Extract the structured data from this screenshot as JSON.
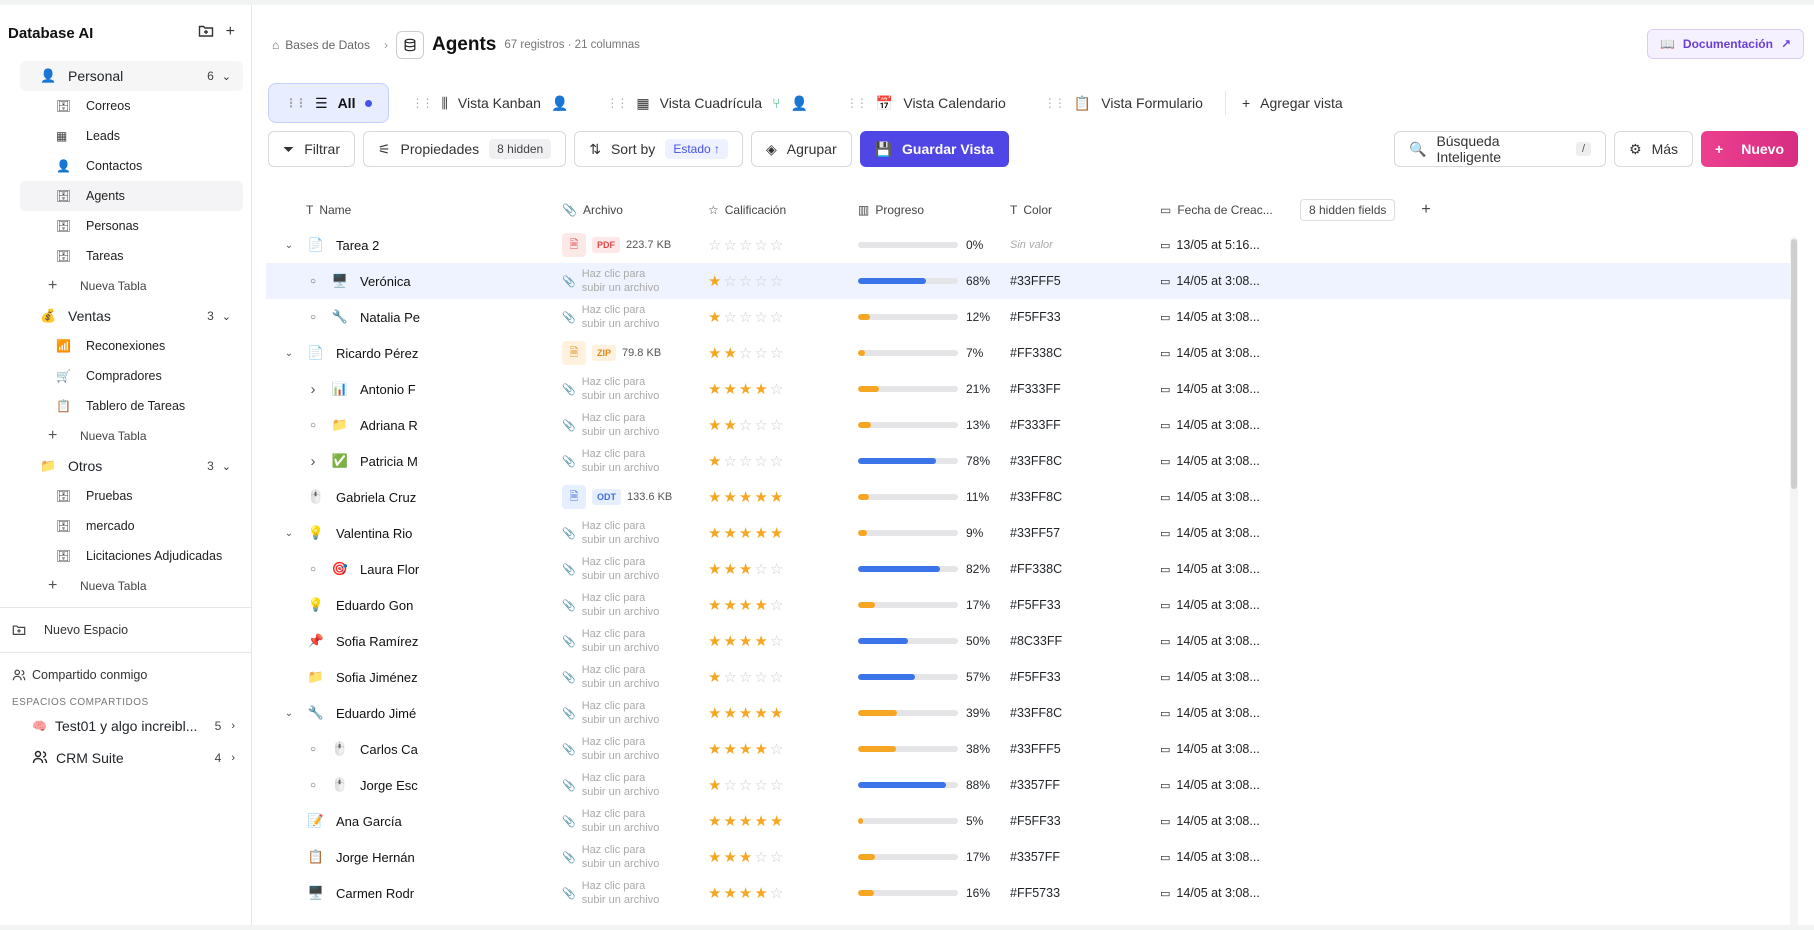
{
  "sidebar": {
    "title": "Database AI",
    "spaces": [
      {
        "name": "Personal",
        "count": "6",
        "icon": "person-icon",
        "tables": [
          "Correos",
          "Leads",
          "Contactos",
          "Agents",
          "Personas",
          "Tareas"
        ],
        "new_label": "Nueva Tabla"
      },
      {
        "name": "Ventas",
        "count": "3",
        "icon": "money-bag-icon",
        "tables": [
          "Reconexiones",
          "Compradores",
          "Tablero de Tareas"
        ],
        "new_label": "Nueva Tabla"
      },
      {
        "name": "Otros",
        "count": "3",
        "icon": "folder-icon",
        "tables": [
          "Pruebas",
          "mercado",
          "Licitaciones Adjudicadas"
        ],
        "new_label": "Nueva Tabla"
      }
    ],
    "new_space": "Nuevo Espacio",
    "shared_with_me": "Compartido conmigo",
    "shared_label": "ESPACIOS COMPARTIDOS",
    "shared": [
      {
        "name": "Test01 y algo increibl...",
        "count": "5"
      },
      {
        "name": "CRM Suite",
        "count": "4"
      }
    ]
  },
  "header": {
    "breadcrumb": "Bases de Datos",
    "title": "Agents",
    "meta": "67 registros · 21 columnas",
    "doc_button": "Documentación"
  },
  "views": {
    "all": "All",
    "kanban": "Vista Kanban",
    "grid": "Vista Cuadrícula",
    "calendar": "Vista Calendario",
    "form": "Vista Formulario",
    "add": "Agregar vista"
  },
  "toolbar": {
    "filter": "Filtrar",
    "props": "Propiedades",
    "props_badge": "8 hidden",
    "sort": "Sort by",
    "sort_badge": "Estado ↑",
    "group": "Agrupar",
    "save": "Guardar Vista",
    "search": "Búsqueda Inteligente",
    "search_key": "/",
    "more": "Más",
    "new": "Nuevo"
  },
  "columns": {
    "name": "Name",
    "file": "Archivo",
    "rating": "Calificación",
    "progress": "Progreso",
    "color": "Color",
    "date": "Fecha de Creac...",
    "hidden": "8 hidden fields"
  },
  "upload_text": [
    "Haz clic para",
    "subir un archivo"
  ],
  "no_value": "Sin valor",
  "rows": [
    {
      "name": "Tarea 2",
      "level": 0,
      "exp": "v",
      "icon": "doc-icon",
      "file": {
        "tag": "PDF",
        "size": "223.7 KB",
        "bg": "#fde8e8",
        "fg": "#e04a4a"
      },
      "rating": 0,
      "progress": 0,
      "color": "Sin valor",
      "date": "13/05 at 5:16..."
    },
    {
      "name": "Verónica",
      "level": 1,
      "exp": "○",
      "icon": "🖥️",
      "rating": 1,
      "progress": 68,
      "color": "#33FFF5",
      "date": "14/05 at 3:08...",
      "hl": true
    },
    {
      "name": "Natalia Pe",
      "level": 1,
      "exp": "○",
      "icon": "🔧",
      "rating": 1,
      "progress": 12,
      "color": "#F5FF33",
      "date": "14/05 at 3:08..."
    },
    {
      "name": "Ricardo Pérez",
      "level": 0,
      "exp": "v",
      "icon": "doc-icon",
      "file": {
        "tag": "ZIP",
        "size": "79.8 KB",
        "bg": "#fff1dd",
        "fg": "#e08a1a"
      },
      "rating": 2,
      "progress": 7,
      "color": "#FF338C",
      "date": "14/05 at 3:08..."
    },
    {
      "name": "Antonio F",
      "level": 1,
      "exp": ">",
      "icon": "📊",
      "rating": 4,
      "progress": 21,
      "color": "#F333FF",
      "date": "14/05 at 3:08..."
    },
    {
      "name": "Adriana R",
      "level": 1,
      "exp": "○",
      "icon": "📁",
      "rating": 2,
      "progress": 13,
      "color": "#F333FF",
      "date": "14/05 at 3:08..."
    },
    {
      "name": "Patricia M",
      "level": 1,
      "exp": ">",
      "icon": "✅",
      "rating": 1,
      "progress": 78,
      "color": "#33FF8C",
      "date": "14/05 at 3:08..."
    },
    {
      "name": "Gabriela Cruz",
      "level": 0,
      "exp": "",
      "icon": "🖱️",
      "file": {
        "tag": "ODT",
        "size": "133.6 KB",
        "bg": "#e6efff",
        "fg": "#3d6fe0"
      },
      "rating": 5,
      "progress": 11,
      "color": "#33FF8C",
      "date": "14/05 at 3:08..."
    },
    {
      "name": "Valentina Rio",
      "level": 0,
      "exp": "v",
      "icon": "💡",
      "rating": 5,
      "progress": 9,
      "color": "#33FF57",
      "date": "14/05 at 3:08..."
    },
    {
      "name": "Laura Flor",
      "level": 1,
      "exp": "○",
      "icon": "🎯",
      "rating": 3,
      "progress": 82,
      "color": "#FF338C",
      "date": "14/05 at 3:08..."
    },
    {
      "name": "Eduardo Gon",
      "level": 0,
      "exp": "",
      "icon": "💡",
      "rating": 4,
      "progress": 17,
      "color": "#F5FF33",
      "date": "14/05 at 3:08..."
    },
    {
      "name": "Sofia Ramírez",
      "level": 0,
      "exp": "",
      "icon": "📌",
      "rating": 4,
      "progress": 50,
      "color": "#8C33FF",
      "date": "14/05 at 3:08..."
    },
    {
      "name": "Sofia Jiménez",
      "level": 0,
      "exp": "",
      "icon": "📁",
      "rating": 1,
      "progress": 57,
      "color": "#F5FF33",
      "date": "14/05 at 3:08..."
    },
    {
      "name": "Eduardo Jimé",
      "level": 0,
      "exp": "v",
      "icon": "🔧",
      "rating": 5,
      "progress": 39,
      "color": "#33FF8C",
      "date": "14/05 at 3:08..."
    },
    {
      "name": "Carlos Ca",
      "level": 1,
      "exp": "○",
      "icon": "🖱️",
      "rating": 4,
      "progress": 38,
      "color": "#33FFF5",
      "date": "14/05 at 3:08..."
    },
    {
      "name": "Jorge Esc",
      "level": 1,
      "exp": "○",
      "icon": "🖱️",
      "rating": 1,
      "progress": 88,
      "color": "#3357FF",
      "date": "14/05 at 3:08..."
    },
    {
      "name": "Ana García",
      "level": 0,
      "exp": "",
      "icon": "📝",
      "rating": 5,
      "progress": 5,
      "color": "#F5FF33",
      "date": "14/05 at 3:08..."
    },
    {
      "name": "Jorge Hernán",
      "level": 0,
      "exp": "",
      "icon": "📋",
      "rating": 3,
      "progress": 17,
      "color": "#3357FF",
      "date": "14/05 at 3:08..."
    },
    {
      "name": "Carmen Rodr",
      "level": 0,
      "exp": "",
      "icon": "🖥️",
      "rating": 4,
      "progress": 16,
      "color": "#FF5733",
      "date": "14/05 at 3:08..."
    }
  ]
}
